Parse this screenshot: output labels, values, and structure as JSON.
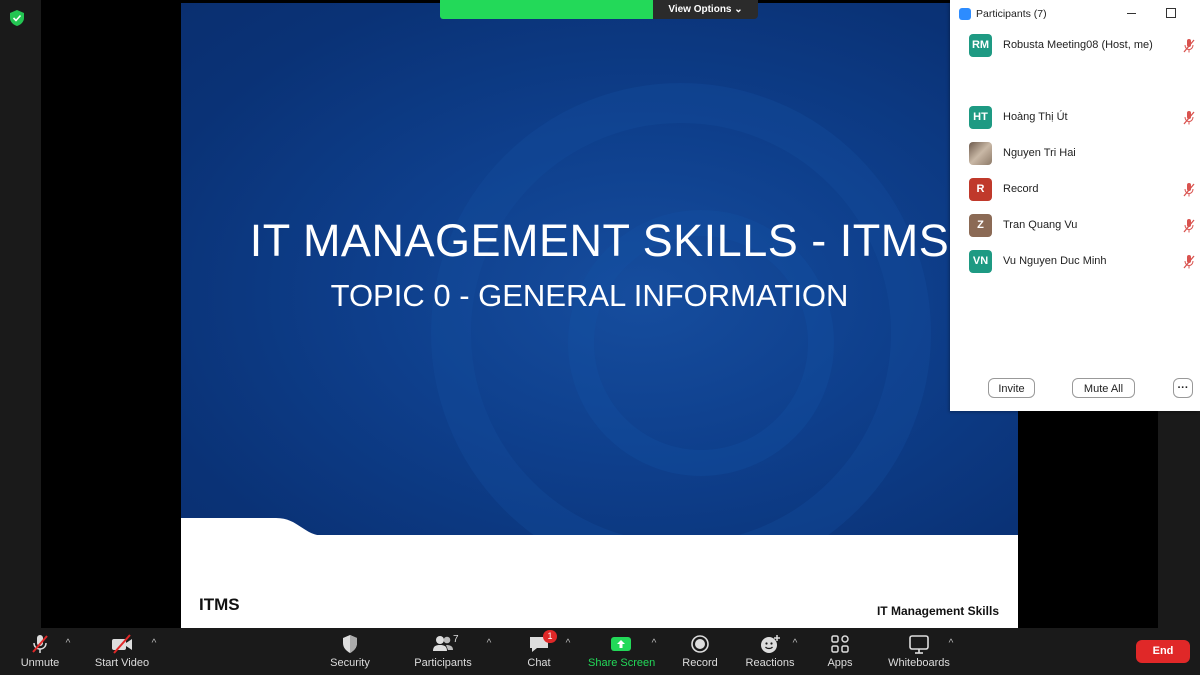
{
  "top_bar": {
    "view_options": "View Options ⌄"
  },
  "slide": {
    "title": "IT MANAGEMENT SKILLS - ITMS",
    "subtitle": "TOPIC 0 - GENERAL INFORMATION",
    "footer_left": "ITMS",
    "footer_right": "IT Management Skills"
  },
  "participants_panel": {
    "title": "Participants (7)",
    "participants": [
      {
        "initials": "RM",
        "name": "Robusta Meeting08 (Host, me)",
        "color": "#1e9a83",
        "muted": true
      },
      {
        "initials": "HT",
        "name": "Hoàng Thị Út",
        "color": "#1e9a83",
        "muted": true
      },
      {
        "initials": "",
        "name": "Nguyen Tri Hai",
        "color": "#8b7766",
        "muted": false
      },
      {
        "initials": "R",
        "name": "Record",
        "color": "#c0392b",
        "muted": true
      },
      {
        "initials": "Z",
        "name": "Tran Quang Vu",
        "color": "#8b6a55",
        "muted": true
      },
      {
        "initials": "VN",
        "name": "Vu Nguyen Duc Minh",
        "color": "#1e9a83",
        "muted": true
      }
    ],
    "invite_label": "Invite",
    "mute_all_label": "Mute All",
    "more_label": "···"
  },
  "toolbar": {
    "unmute": "Unmute",
    "start_video": "Start Video",
    "security": "Security",
    "participants": "Participants",
    "participants_count": "7",
    "chat": "Chat",
    "chat_badge": "1",
    "share_screen": "Share Screen",
    "record": "Record",
    "reactions": "Reactions",
    "apps": "Apps",
    "whiteboards": "Whiteboards",
    "end": "End",
    "caret": "^"
  },
  "colors": {
    "share_green": "#23d959",
    "end_red": "#e02828",
    "slide_blue": "#0e3f8c"
  }
}
